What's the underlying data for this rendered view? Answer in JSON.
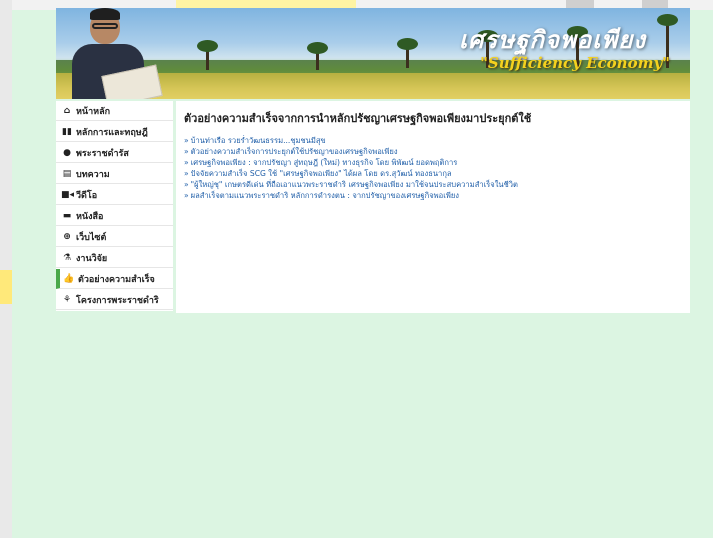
{
  "banner": {
    "title": "เศรษฐกิจพอเพียง",
    "subtitle": "\"Sufficiency Economy\""
  },
  "sidebar": {
    "items": [
      {
        "label": "หน้าหลัก",
        "icon": "home-icon",
        "glyph": "⌂",
        "active": false
      },
      {
        "label": "หลักการและทฤษฎี",
        "icon": "book-icon",
        "glyph": "▮▮",
        "active": false
      },
      {
        "label": "พระราชดำรัส",
        "icon": "speech-bubble-icon",
        "glyph": "●",
        "active": false
      },
      {
        "label": "บทความ",
        "icon": "document-icon",
        "glyph": "▤",
        "active": false
      },
      {
        "label": "วีดีโอ",
        "icon": "video-icon",
        "glyph": "■◂",
        "active": false
      },
      {
        "label": "หนังสือ",
        "icon": "book-closed-icon",
        "glyph": "▬",
        "active": false
      },
      {
        "label": "เว็บไซต์",
        "icon": "globe-icon",
        "glyph": "⊕",
        "active": false
      },
      {
        "label": "งานวิจัย",
        "icon": "flask-icon",
        "glyph": "⚗",
        "active": false
      },
      {
        "label": "ตัวอย่างความสำเร็จ",
        "icon": "thumbs-up-icon",
        "glyph": "👍",
        "active": true
      },
      {
        "label": "โครงการพระราชดำริ",
        "icon": "handshake-icon",
        "glyph": "⚘",
        "active": false
      }
    ]
  },
  "main": {
    "heading": "ตัวอย่างความสำเร็จจากการนำหลักปรัชญาเศรษฐกิจพอเพียงมาประยุกต์ใช้",
    "links": [
      "บ้านท่าเรือ รวยร่ำวัฒนธรรม...ชุมชนมีสุข",
      "ตัวอย่างความสำเร็จการประยุกต์ใช้ปรัชญาของเศรษฐกิจพอเพียง",
      "เศรษฐกิจพอเพียง : จากปรัชญา สู่ทฤษฎี (ใหม่) ทางธุรกิจ โดย พิพัฒน์ ยอดพฤติการ",
      "ปัจจัยความสำเร็จ SCG ใช้ \"เศรษฐกิจพอเพียง\" ได้ผล โดย ดร.สุวัฒน์ ทองธนากุล",
      "\"ผู้ใหญ่ชุ\" เกษตรดีเด่น ที่ถือเอาแนวพระราชดำริ เศรษฐกิจพอเพียง มาใช้จนประสบความสำเร็จในชีวิต",
      "ผลสำเร็จตามแนวพระราชดำริ หลักการดำรงตน : จากปรัชญาของเศรษฐกิจพอเพียง"
    ]
  }
}
